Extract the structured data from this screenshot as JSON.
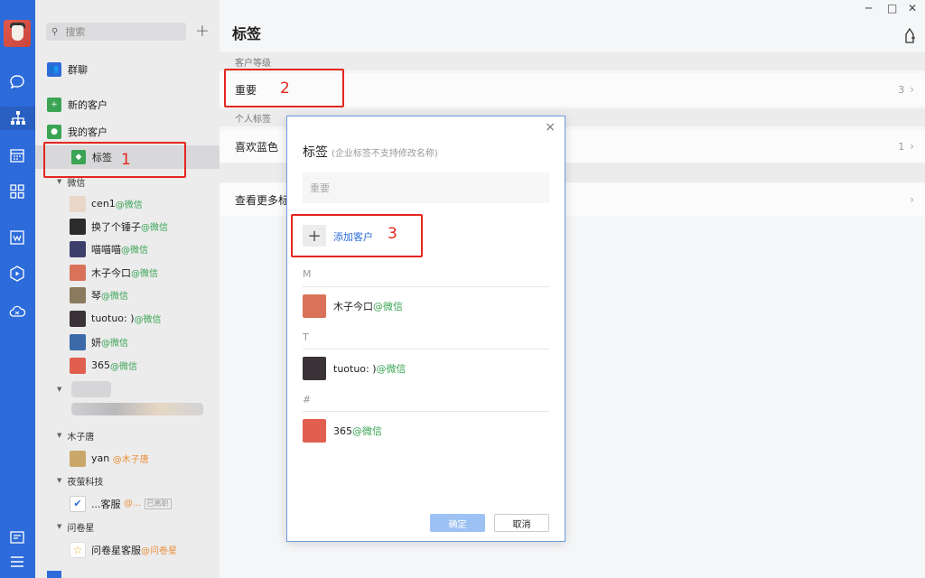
{
  "rail": {
    "icons": [
      "avatar",
      "chat-icon",
      "org-chart-icon",
      "calendar-icon",
      "apps-icon",
      "doc-icon",
      "drive-icon",
      "cloud-icon",
      "notes-icon",
      "menu-icon"
    ]
  },
  "sidebar": {
    "search_placeholder": "搜索",
    "plus": "+",
    "group_chat": "群聊",
    "new_customers": "新的客户",
    "my_customers": "我的客户",
    "tags": "标签",
    "groups": [
      {
        "name": "微信"
      },
      {
        "name": "木子唐"
      },
      {
        "name": "夜萤科技"
      },
      {
        "name": "问卷星"
      }
    ],
    "wechat_contacts": [
      {
        "name": "cen1",
        "src": "@微信"
      },
      {
        "name": "换了个锤子",
        "src": "@微信"
      },
      {
        "name": "喵喵喵",
        "src": "@微信"
      },
      {
        "name": "木子今口",
        "src": "@微信"
      },
      {
        "name": "琴",
        "src": "@微信"
      },
      {
        "name": "tuotuo: )",
        "src": "@微信"
      },
      {
        "name": "妍",
        "src": "@微信"
      },
      {
        "name": "365",
        "src": "@微信"
      }
    ],
    "muzi_contact": {
      "name": "yan",
      "src": "@木子唐"
    },
    "yeying_contact": {
      "name": "...客服",
      "src": "@...",
      "badge": "已离职"
    },
    "wjx_contact": {
      "name": "问卷星客服",
      "src": "@问卷星"
    }
  },
  "window": {
    "minimize": "─",
    "maximize": "□",
    "close": "✕"
  },
  "main": {
    "title": "标签",
    "section_level": "客户等级",
    "row_important": "重要",
    "row_important_count": "3",
    "section_personal": "个人标签",
    "row_blue": "喜欢蓝色",
    "row_blue_count": "1",
    "row_more": "查看更多标",
    "chevron": "›"
  },
  "annotations": {
    "one": "1",
    "two": "2",
    "three": "3"
  },
  "dialog": {
    "close": "×",
    "title": "标签",
    "title_note": "(企业标签不支持修改名称)",
    "input_value": "重要",
    "add_label": "添加客户",
    "add_symbol": "+",
    "sections": [
      {
        "letter": "M",
        "name": "木子今口",
        "src": "@微信"
      },
      {
        "letter": "T",
        "name": "tuotuo: )",
        "src": "@微信"
      },
      {
        "letter": "#",
        "name": "365",
        "src": "@微信"
      }
    ],
    "ok": "确定",
    "cancel": "取消"
  },
  "colors": {
    "rail": "#2c6bd9",
    "accent": "#2c6bd9",
    "wechat_green": "#3aa454",
    "annotation_red": "#e4261f"
  }
}
